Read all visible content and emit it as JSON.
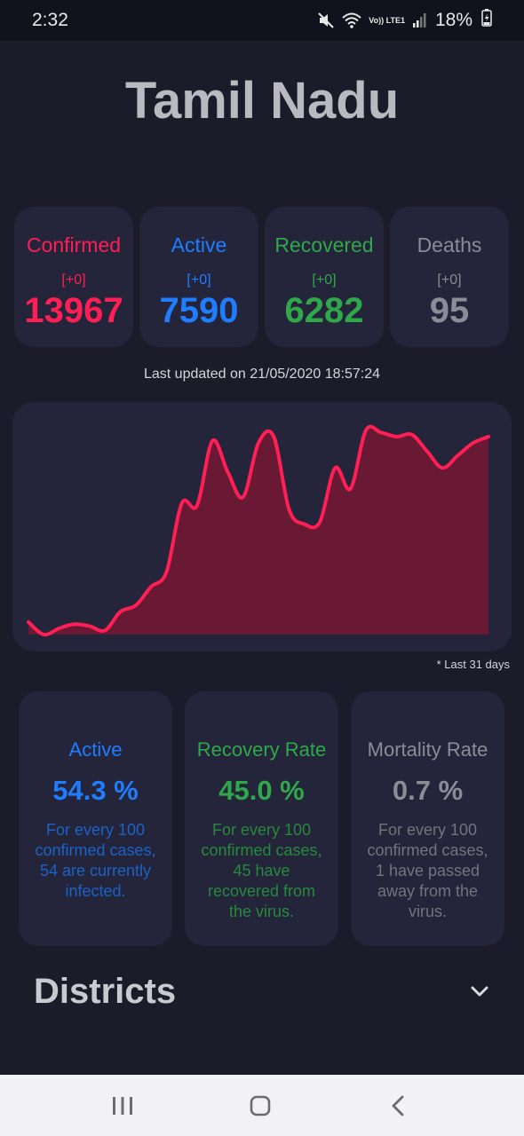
{
  "status_bar": {
    "time": "2:32",
    "battery": "18%",
    "network_label": "Vo)) LTE1",
    "icons": [
      "mute-icon",
      "wifi-icon",
      "signal-icon",
      "battery-icon"
    ]
  },
  "state": {
    "name": "Tamil Nadu"
  },
  "stats": {
    "confirmed": {
      "label": "Confirmed",
      "delta": "[+0]",
      "value": "13967",
      "color": "#ff1f55"
    },
    "active": {
      "label": "Active",
      "delta": "[+0]",
      "value": "7590",
      "color": "#1f7dff"
    },
    "recovered": {
      "label": "Recovered",
      "delta": "[+0]",
      "value": "6282",
      "color": "#2fa84a"
    },
    "deaths": {
      "label": "Deaths",
      "delta": "[+0]",
      "value": "95",
      "color": "#8c8c96"
    }
  },
  "last_updated": "Last updated on 21/05/2020 18:57:24",
  "chart_data": {
    "type": "area",
    "x": [
      1,
      2,
      3,
      4,
      5,
      6,
      7,
      8,
      9,
      10,
      11,
      12,
      13,
      14,
      15,
      16,
      17,
      18,
      19,
      20,
      21,
      22,
      23,
      24,
      25,
      26,
      27,
      28,
      29,
      30,
      31
    ],
    "values": [
      6,
      0,
      3,
      5,
      4,
      2,
      11,
      14,
      23,
      30,
      63,
      62,
      93,
      78,
      66,
      92,
      95,
      60,
      53,
      54,
      80,
      70,
      98,
      97,
      95,
      96,
      88,
      80,
      86,
      92,
      95
    ],
    "series": [
      {
        "values": [
          6,
          0,
          3,
          5,
          4,
          2,
          11,
          14,
          23,
          30,
          63,
          62,
          93,
          78,
          66,
          92,
          95,
          60,
          53,
          54,
          80,
          70,
          98,
          97,
          95,
          96,
          88,
          80,
          86,
          92,
          95
        ]
      }
    ],
    "title": "",
    "xlabel": "",
    "ylabel": "",
    "grid": false,
    "line_color": "#ff1f55",
    "fill_color": "#6a1935"
  },
  "chart_footnote": "* Last 31 days",
  "rates": {
    "active": {
      "label": "Active",
      "value": "54.3 %",
      "desc": "For every 100 confirmed cases, 54 are currently infected.",
      "color": "#1f7dff",
      "desc_color": "#1a63c8"
    },
    "recovery": {
      "label": "Recovery Rate",
      "value": "45.0 %",
      "desc": "For every 100 confirmed cases, 45 have recovered from the virus.",
      "color": "#2fa84a",
      "desc_color": "#268a3d"
    },
    "mortality": {
      "label": "Mortality Rate",
      "value": "0.7 %",
      "desc": "For every 100 confirmed cases, 1 have passed away from the virus.",
      "color": "#8c8c96",
      "desc_color": "#74747e"
    }
  },
  "districts": {
    "title": "Districts"
  },
  "nav": {
    "buttons": [
      "recent-apps",
      "home",
      "back"
    ]
  }
}
